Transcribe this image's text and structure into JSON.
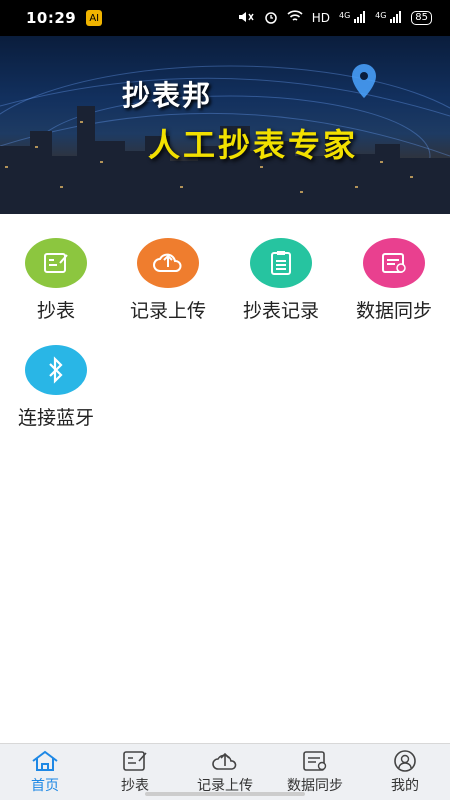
{
  "status": {
    "time": "10:29",
    "badge": "AI",
    "network": "HD",
    "signal1": "4G",
    "signal2": "4G",
    "battery": "85"
  },
  "banner": {
    "title": "抄表邦",
    "subtitle": "人工抄表专家"
  },
  "grid": {
    "items": [
      {
        "label": "抄表",
        "icon": "meter-note-icon",
        "color": "#8cc63f"
      },
      {
        "label": "记录上传",
        "icon": "cloud-upload-icon",
        "color": "#ef7d2e"
      },
      {
        "label": "抄表记录",
        "icon": "clipboard-list-icon",
        "color": "#26c4a0"
      },
      {
        "label": "数据同步",
        "icon": "sync-document-icon",
        "color": "#e9408f"
      },
      {
        "label": "连接蓝牙",
        "icon": "bluetooth-icon",
        "color": "#29b6e6"
      }
    ]
  },
  "tabbar": {
    "items": [
      {
        "label": "首页",
        "icon": "home-icon",
        "active": true
      },
      {
        "label": "抄表",
        "icon": "meter-note-icon"
      },
      {
        "label": "记录上传",
        "icon": "cloud-upload-icon"
      },
      {
        "label": "数据同步",
        "icon": "sync-document-icon"
      },
      {
        "label": "我的",
        "icon": "user-icon"
      }
    ],
    "active_color": "#1e88e5"
  }
}
